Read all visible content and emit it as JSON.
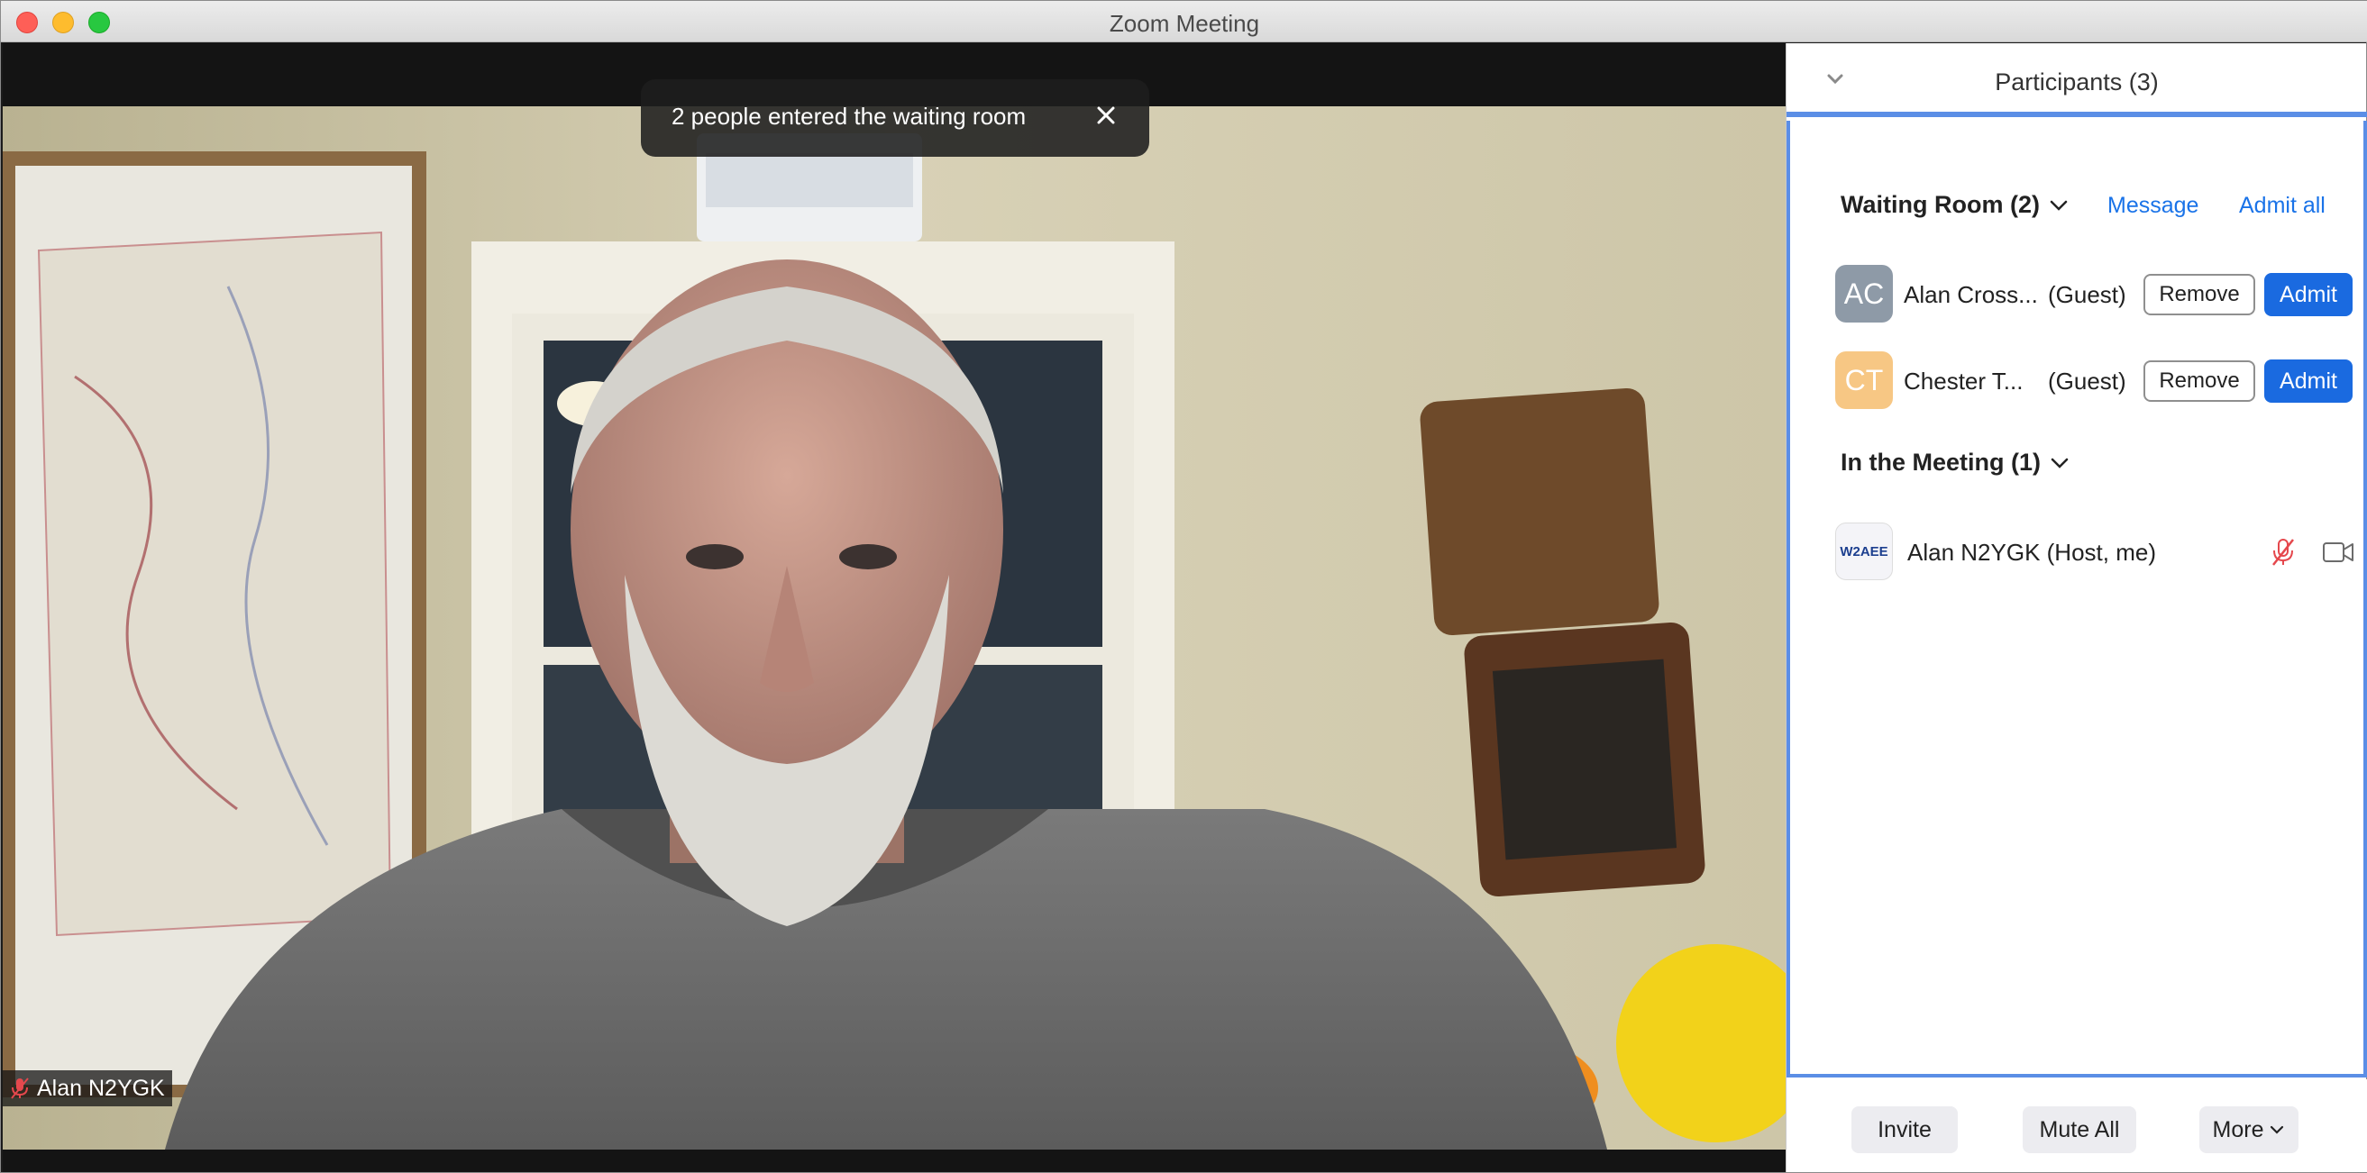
{
  "window": {
    "title": "Zoom Meeting"
  },
  "toast": {
    "text": "2 people entered the waiting room"
  },
  "video": {
    "name_tag": "Alan N2YGK"
  },
  "panel": {
    "title": "Participants (3)",
    "waiting_room": {
      "label": "Waiting Room (2)",
      "message_link": "Message",
      "admit_all_link": "Admit all",
      "participants": [
        {
          "initials": "AC",
          "name": "Alan Cross...",
          "role": "(Guest)",
          "avatar_color": "#8e9aa7",
          "remove_label": "Remove",
          "admit_label": "Admit"
        },
        {
          "initials": "CT",
          "name": "Chester T...",
          "role": "(Guest)",
          "avatar_color": "#f7c784",
          "remove_label": "Remove",
          "admit_label": "Admit"
        }
      ]
    },
    "in_meeting": {
      "label": "In the Meeting (1)",
      "participants": [
        {
          "avatar_text": "W2AEE",
          "name": "Alan N2YGK (Host, me)"
        }
      ]
    },
    "footer": {
      "invite": "Invite",
      "mute_all": "Mute All",
      "more": "More"
    }
  },
  "colors": {
    "accent": "#1a6ae0",
    "muted_red": "#e5484d",
    "panel_border": "#5b8ee6"
  }
}
